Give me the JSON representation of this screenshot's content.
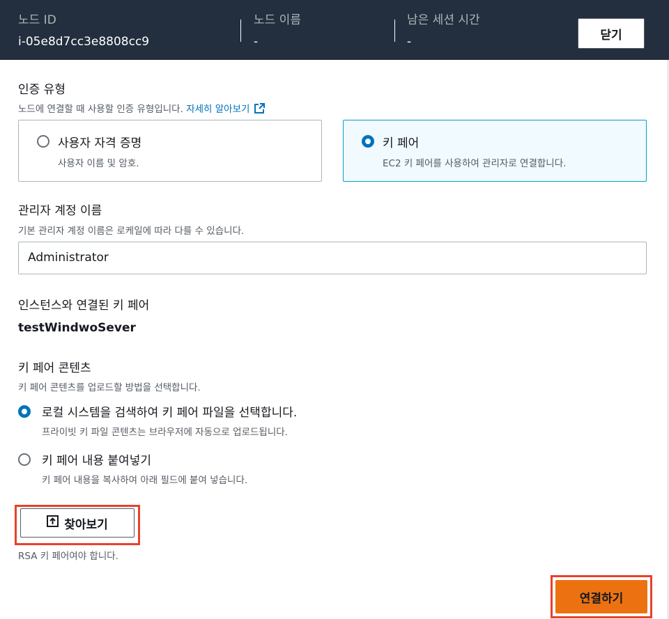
{
  "header": {
    "node_id_label": "노드 ID",
    "node_id_value": "i-05e8d7cc3e8808cc9",
    "node_name_label": "노드 이름",
    "node_name_value": "-",
    "session_time_label": "남은 세션 시간",
    "session_time_value": "-",
    "close_label": "닫기"
  },
  "auth": {
    "title": "인증 유형",
    "description": "노드에 연결할 때 사용할 인증 유형입니다.",
    "learn_more": "자세히 알아보기",
    "options": [
      {
        "title": "사용자 자격 증명",
        "description": "사용자 이름 및 암호.",
        "selected": false
      },
      {
        "title": "키 페어",
        "description": "EC2 키 페어를 사용하여 관리자로 연결합니다.",
        "selected": true
      }
    ]
  },
  "admin": {
    "title": "관리자 계정 이름",
    "description": "기본 관리자 계정 이름은 로케일에 따라 다를 수 있습니다.",
    "value": "Administrator"
  },
  "keypair": {
    "label": "인스턴스와 연결된 키 페어",
    "value": "testWindwoSever"
  },
  "content": {
    "title": "키 페어 콘텐츠",
    "description": "키 페어 콘텐츠를 업로드할 방법을 선택합니다.",
    "options": [
      {
        "title": "로컬 시스템을 검색하여 키 페어 파일을 선택합니다.",
        "description": "프라이빗 키 파일 콘텐츠는 브라우저에 자동으로 업로드됩니다.",
        "selected": true
      },
      {
        "title": "키 페어 내용 붙여넣기",
        "description": "키 페어 내용을 복사하여 아래 필드에 붙여 넣습니다.",
        "selected": false
      }
    ],
    "browse_label": "찾아보기",
    "browse_hint": "RSA 키 페어여야 합니다."
  },
  "footer": {
    "connect_label": "연결하기"
  },
  "colors": {
    "header_bg": "#232f3e",
    "accent": "#0073bb",
    "primary_button": "#ec7211",
    "highlight_box": "#e8412b"
  }
}
